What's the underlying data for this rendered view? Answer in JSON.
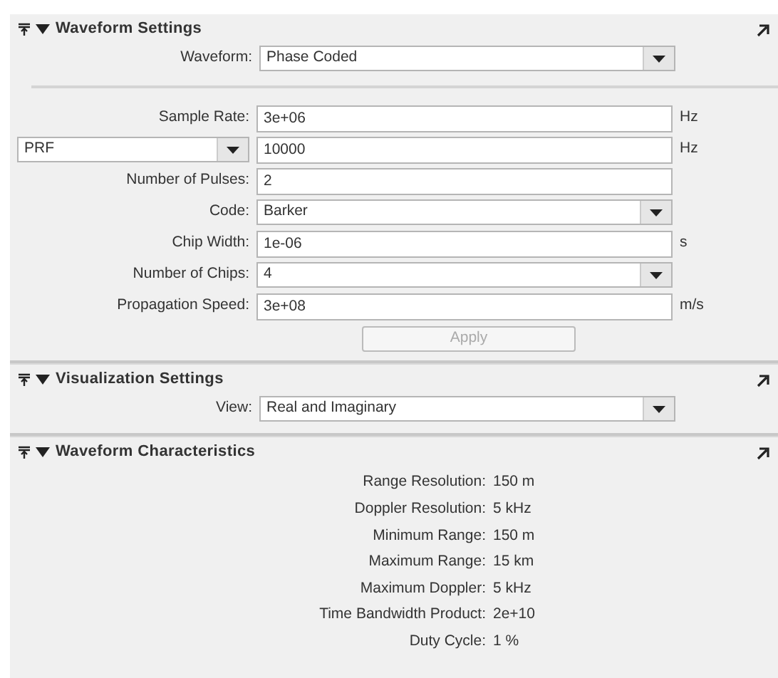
{
  "sections": [
    {
      "kind": "settings",
      "title": "Waveform Settings",
      "expanded": true,
      "top_fields": [
        {
          "kind": "select",
          "label": "Waveform:",
          "value": "Phase Coded"
        }
      ],
      "fields": [
        {
          "kind": "input",
          "label": "Sample Rate:",
          "value": "3e+06",
          "unit": "Hz"
        },
        {
          "kind": "input",
          "label_select": "PRF",
          "value": "10000",
          "unit": "Hz"
        },
        {
          "kind": "input",
          "label": "Number of Pulses:",
          "value": "2"
        },
        {
          "kind": "select",
          "label": "Code:",
          "value": "Barker"
        },
        {
          "kind": "input",
          "label": "Chip Width:",
          "value": "1e-06",
          "unit": "s"
        },
        {
          "kind": "select",
          "label": "Number of Chips:",
          "value": "4"
        },
        {
          "kind": "input",
          "label": "Propagation Speed:",
          "value": "3e+08",
          "unit": "m/s"
        }
      ],
      "apply": {
        "label": "Apply",
        "disabled": true
      }
    },
    {
      "kind": "settings",
      "title": "Visualization Settings",
      "expanded": true,
      "top_fields": [
        {
          "kind": "select",
          "label": "View:",
          "value": "Real and Imaginary"
        }
      ]
    },
    {
      "kind": "characteristics",
      "title": "Waveform Characteristics",
      "expanded": true,
      "items": [
        {
          "label": "Range Resolution:",
          "value": "150 m"
        },
        {
          "label": "Doppler Resolution:",
          "value": "5 kHz"
        },
        {
          "label": "Minimum Range:",
          "value": "150 m"
        },
        {
          "label": "Maximum Range:",
          "value": "15 km"
        },
        {
          "label": "Maximum Doppler:",
          "value": "5 kHz"
        },
        {
          "label": "Time Bandwidth Product:",
          "value": "2e+10"
        },
        {
          "label": "Duty Cycle:",
          "value": "1 %"
        }
      ]
    }
  ]
}
